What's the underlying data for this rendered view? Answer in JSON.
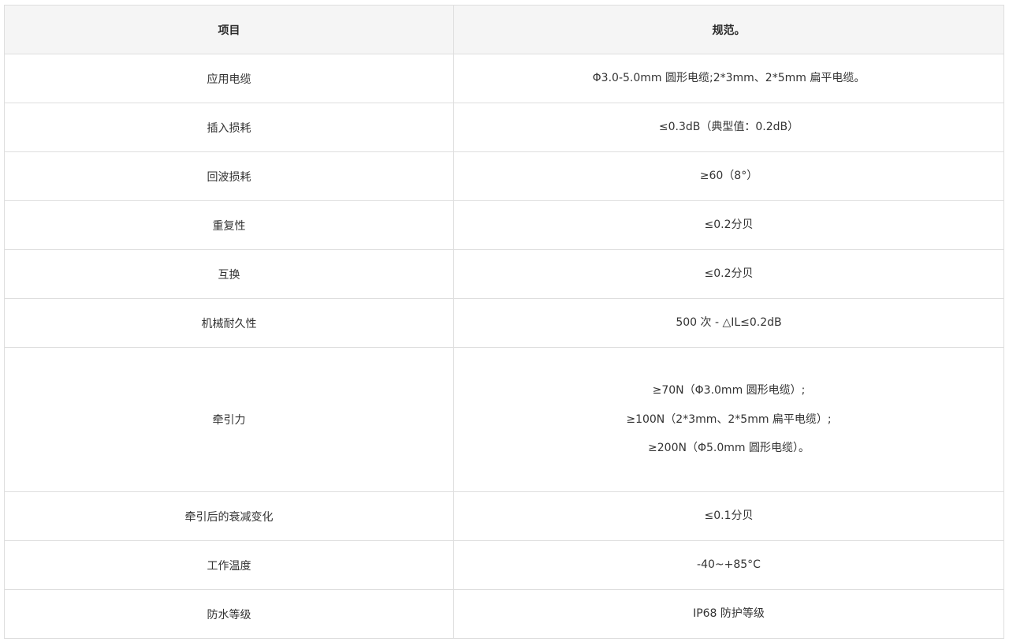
{
  "table": {
    "headers": [
      "项目",
      "规范。"
    ],
    "rows": [
      {
        "item": "应用电缆",
        "spec": [
          "Φ3.0-5.0mm 圆形电缆;2*3mm、2*5mm 扁平电缆。"
        ]
      },
      {
        "item": "插入损耗",
        "spec": [
          "≤0.3dB（典型值：0.2dB）"
        ]
      },
      {
        "item": "回波损耗",
        "spec": [
          "≥60（8°）"
        ]
      },
      {
        "item": "重复性",
        "spec": [
          "≤0.2分贝"
        ]
      },
      {
        "item": "互换",
        "spec": [
          "≤0.2分贝"
        ]
      },
      {
        "item": "机械耐久性",
        "spec": [
          "500 次 - △IL≤0.2dB"
        ]
      },
      {
        "item": "牵引力",
        "spec": [
          "≥70N（Φ3.0mm 圆形电缆）;",
          "≥100N（2*3mm、2*5mm 扁平电缆）;",
          "≥200N（Φ5.0mm 圆形电缆）。"
        ]
      },
      {
        "item": "牵引后的衰减变化",
        "spec": [
          "≤0.1分贝"
        ]
      },
      {
        "item": "工作温度",
        "spec": [
          "-40~+85°C"
        ]
      },
      {
        "item": "防水等级",
        "spec": [
          "IP68 防护等级"
        ]
      }
    ]
  }
}
